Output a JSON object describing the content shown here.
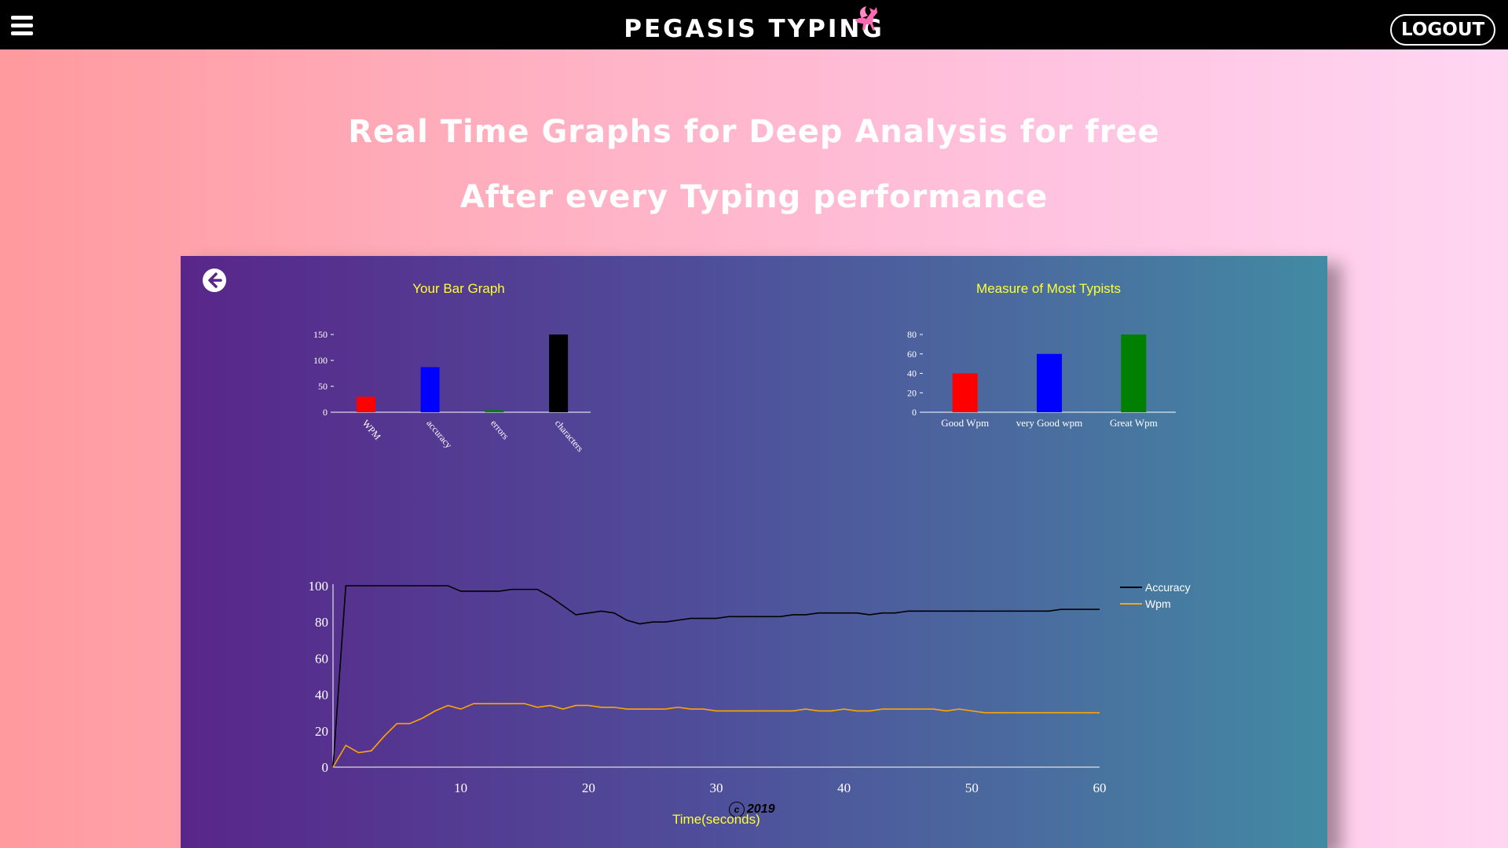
{
  "header": {
    "title": "PEGASIS TYPING",
    "logout_label": "LOGOUT",
    "menu_icon": "hamburger-menu-icon",
    "logo_icon": "pegasus-icon",
    "logo_color": "#ff69b4"
  },
  "hero": {
    "line1": "Real Time Graphs for Deep Analysis for free",
    "line2": "After every Typing performance"
  },
  "panel": {
    "back_icon": "arrow-left-circle-icon"
  },
  "chart_data": [
    {
      "type": "bar",
      "title": "Your Bar Graph",
      "categories": [
        "WPM",
        "accuracy",
        "errors",
        "characters"
      ],
      "values": [
        30,
        87,
        4,
        150
      ],
      "colors": [
        "#ff0000",
        "#0000ff",
        "#008000",
        "#000000"
      ],
      "ylim": [
        0,
        150
      ],
      "yticks": [
        0,
        50,
        100,
        150
      ]
    },
    {
      "type": "bar",
      "title": "Measure of Most Typists",
      "categories": [
        "Good Wpm",
        "very Good wpm",
        "Great Wpm"
      ],
      "values": [
        40,
        60,
        80
      ],
      "colors": [
        "#ff0000",
        "#0000ff",
        "#008000"
      ],
      "ylim": [
        0,
        80
      ],
      "yticks": [
        0,
        20,
        40,
        60,
        80
      ]
    },
    {
      "type": "line",
      "xlabel": "Time(seconds)",
      "xlim": [
        0,
        60
      ],
      "ylim": [
        0,
        100
      ],
      "xticks": [
        10,
        20,
        30,
        40,
        50,
        60
      ],
      "yticks": [
        0,
        20,
        40,
        60,
        80,
        100
      ],
      "legend": "top-right",
      "series": [
        {
          "name": "Accuracy",
          "color": "#000000",
          "x": [
            0,
            1,
            2,
            3,
            4,
            5,
            6,
            7,
            8,
            9,
            10,
            11,
            12,
            13,
            14,
            15,
            16,
            17,
            18,
            19,
            20,
            21,
            22,
            23,
            24,
            25,
            26,
            27,
            28,
            29,
            30,
            31,
            32,
            33,
            34,
            35,
            36,
            37,
            38,
            39,
            40,
            41,
            42,
            43,
            44,
            45,
            46,
            47,
            48,
            49,
            50,
            51,
            52,
            53,
            54,
            55,
            56,
            57,
            58,
            59,
            60
          ],
          "values": [
            0,
            100,
            100,
            100,
            100,
            100,
            100,
            100,
            100,
            100,
            97,
            97,
            97,
            97,
            98,
            98,
            98,
            94,
            89,
            84,
            85,
            86,
            85,
            81,
            79,
            80,
            80,
            81,
            82,
            82,
            82,
            83,
            83,
            83,
            83,
            83,
            84,
            84,
            85,
            85,
            85,
            85,
            84,
            85,
            85,
            86,
            86,
            86,
            86,
            86,
            86,
            86,
            86,
            86,
            86,
            86,
            86,
            87,
            87,
            87,
            87
          ]
        },
        {
          "name": "Wpm",
          "color": "#ffa500",
          "x": [
            0,
            1,
            2,
            3,
            4,
            5,
            6,
            7,
            8,
            9,
            10,
            11,
            12,
            13,
            14,
            15,
            16,
            17,
            18,
            19,
            20,
            21,
            22,
            23,
            24,
            25,
            26,
            27,
            28,
            29,
            30,
            31,
            32,
            33,
            34,
            35,
            36,
            37,
            38,
            39,
            40,
            41,
            42,
            43,
            44,
            45,
            46,
            47,
            48,
            49,
            50,
            51,
            52,
            53,
            54,
            55,
            56,
            57,
            58,
            59,
            60
          ],
          "values": [
            0,
            12,
            8,
            9,
            17,
            24,
            24,
            27,
            31,
            34,
            32,
            35,
            35,
            35,
            35,
            35,
            33,
            34,
            32,
            34,
            34,
            33,
            33,
            32,
            32,
            32,
            32,
            33,
            32,
            32,
            31,
            31,
            31,
            31,
            31,
            31,
            31,
            32,
            31,
            31,
            32,
            31,
            31,
            32,
            32,
            32,
            32,
            32,
            31,
            32,
            31,
            30,
            30,
            30,
            30,
            30,
            30,
            30,
            30,
            30,
            30
          ]
        }
      ]
    }
  ],
  "footer": {
    "copyright_symbol": "c",
    "year": "2019"
  }
}
